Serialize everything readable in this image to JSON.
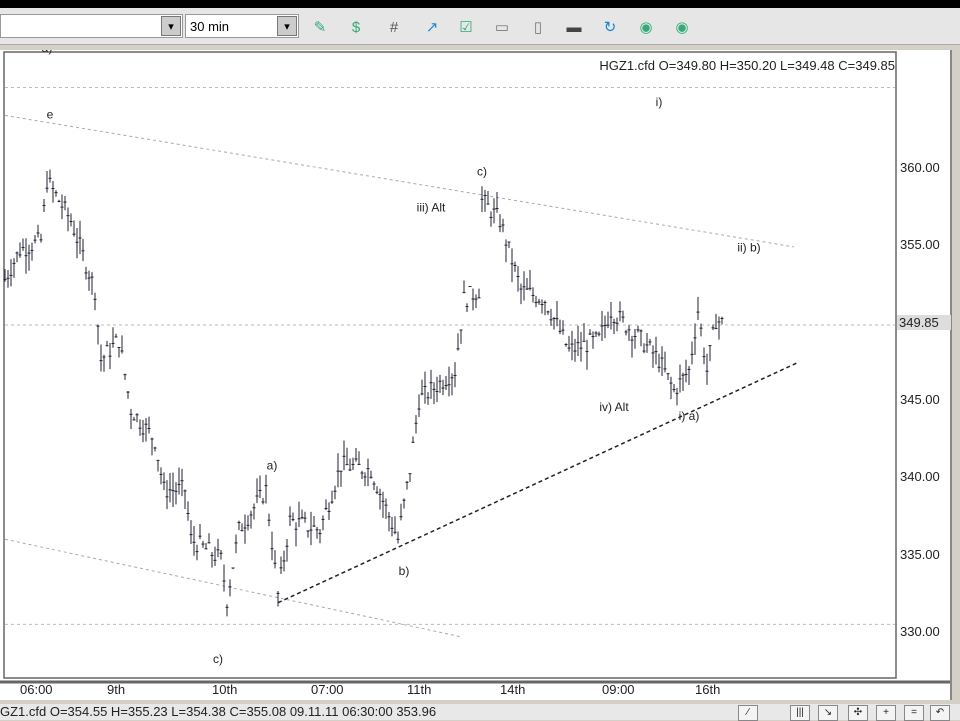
{
  "toolbar": {
    "symbol_value": "",
    "interval_value": "30 min",
    "icons": [
      "add-study-icon",
      "study-icon",
      "grid-icon",
      "chart-up-icon",
      "edit-chart-icon",
      "chart-icon",
      "page-icon",
      "print-icon",
      "refresh-icon",
      "next-chart-icon",
      "prev-chart-icon"
    ]
  },
  "chart_data": {
    "type": "bar",
    "title": "HGZ1.cfd O=349.80 H=350.20 L=349.48 C=349.85",
    "last_price": "349.85",
    "ylim": [
      327,
      369
    ],
    "xlim": [
      0,
      298
    ],
    "y_ticks": [
      "330.00",
      "335.00",
      "340.00",
      "345.00",
      "350.00",
      "355.00",
      "360.00"
    ],
    "y_tick_values": [
      330,
      335,
      340,
      345,
      350,
      355,
      360
    ],
    "x_ticks": [
      {
        "label": "06:00",
        "bar": 11
      },
      {
        "label": "9th",
        "bar": 40
      },
      {
        "label": "10th",
        "bar": 75
      },
      {
        "label": "07:00",
        "bar": 108
      },
      {
        "label": "11th",
        "bar": 140
      },
      {
        "label": "14th",
        "bar": 171
      },
      {
        "label": "09:00",
        "bar": 205
      },
      {
        "label": "16th",
        "bar": 236
      }
    ],
    "price_path": [
      [
        0,
        352.8
      ],
      [
        5,
        354.7
      ],
      [
        12,
        355.3
      ],
      [
        14,
        359.2
      ],
      [
        22,
        356.6
      ],
      [
        30,
        352.1
      ],
      [
        32,
        347.6
      ],
      [
        38,
        348.9
      ],
      [
        42,
        344.4
      ],
      [
        50,
        342.4
      ],
      [
        53,
        339.2
      ],
      [
        60,
        339.2
      ],
      [
        62,
        336.0
      ],
      [
        72,
        334.7
      ],
      [
        74,
        332.1
      ],
      [
        78,
        336.6
      ],
      [
        87,
        339.2
      ],
      [
        91,
        332.4
      ],
      [
        95,
        337.2
      ],
      [
        105,
        336.6
      ],
      [
        112,
        340.8
      ],
      [
        122,
        340.5
      ],
      [
        131,
        336.0
      ],
      [
        135,
        340.5
      ],
      [
        138,
        345.0
      ],
      [
        150,
        346.9
      ],
      [
        153,
        351.5
      ],
      [
        158,
        352.1
      ],
      [
        159,
        357.9
      ],
      [
        165,
        356.6
      ],
      [
        172,
        352.1
      ],
      [
        180,
        351.5
      ],
      [
        188,
        348.2
      ],
      [
        198,
        348.9
      ],
      [
        202,
        350.8
      ],
      [
        212,
        348.9
      ],
      [
        218,
        347.6
      ],
      [
        223,
        345.6
      ],
      [
        228,
        346.9
      ],
      [
        231,
        350.8
      ],
      [
        234,
        346.9
      ],
      [
        237,
        350.2
      ],
      [
        240,
        349.85
      ]
    ],
    "lines": [
      {
        "name": "upper-trendline",
        "style": "dotted",
        "from": [
          0,
          363.4
        ],
        "to": [
          263,
          354.9
        ]
      },
      {
        "name": "lower-trendline",
        "style": "dashed",
        "from": [
          91,
          331.9
        ],
        "to": [
          264,
          347.4
        ]
      },
      {
        "name": "lower-channel-line",
        "style": "dotted",
        "from": [
          0,
          336.0
        ],
        "to": [
          152,
          329.7
        ]
      },
      {
        "name": "grid-365",
        "style": "hgrid",
        "from": [
          0,
          365.2
        ],
        "to": [
          298,
          365.2
        ]
      },
      {
        "name": "grid-last",
        "style": "hgrid",
        "from": [
          0,
          349.85
        ],
        "to": [
          298,
          349.85
        ]
      },
      {
        "name": "grid-330",
        "style": "hgrid",
        "from": [
          0,
          330.5
        ],
        "to": [
          298,
          330.5
        ]
      }
    ],
    "annotations": [
      {
        "text": "a)",
        "bar": 14,
        "price": 367.5
      },
      {
        "text": "e",
        "bar": 15,
        "price": 363.2
      },
      {
        "text": "c)",
        "bar": 159,
        "price": 359.5
      },
      {
        "text": "iii) Alt",
        "bar": 142,
        "price": 357.2
      },
      {
        "text": "i)",
        "bar": 218,
        "price": 364.0
      },
      {
        "text": "ii) b)",
        "bar": 248,
        "price": 354.6
      },
      {
        "text": "iv) Alt",
        "bar": 203,
        "price": 344.3
      },
      {
        "text": "i) a)",
        "bar": 228,
        "price": 343.7
      },
      {
        "text": "a)",
        "bar": 89,
        "price": 340.5
      },
      {
        "text": "b)",
        "bar": 133,
        "price": 333.7
      },
      {
        "text": "c)",
        "bar": 71,
        "price": 328.0
      }
    ]
  },
  "status": {
    "text": "GZ1.cfd O=354.55 H=355.23 L=354.38 C=355.08   09.11.11 06:30:00 353.96",
    "buttons": [
      "draw-icon",
      "bars-icon",
      "line-icon",
      "crosshair-icon",
      "zoom-in-icon",
      "zoom-out-icon",
      "undo-icon"
    ],
    "glyphs": [
      "∕",
      "|||",
      "↘",
      "✣",
      "+",
      "=",
      "↶"
    ]
  }
}
